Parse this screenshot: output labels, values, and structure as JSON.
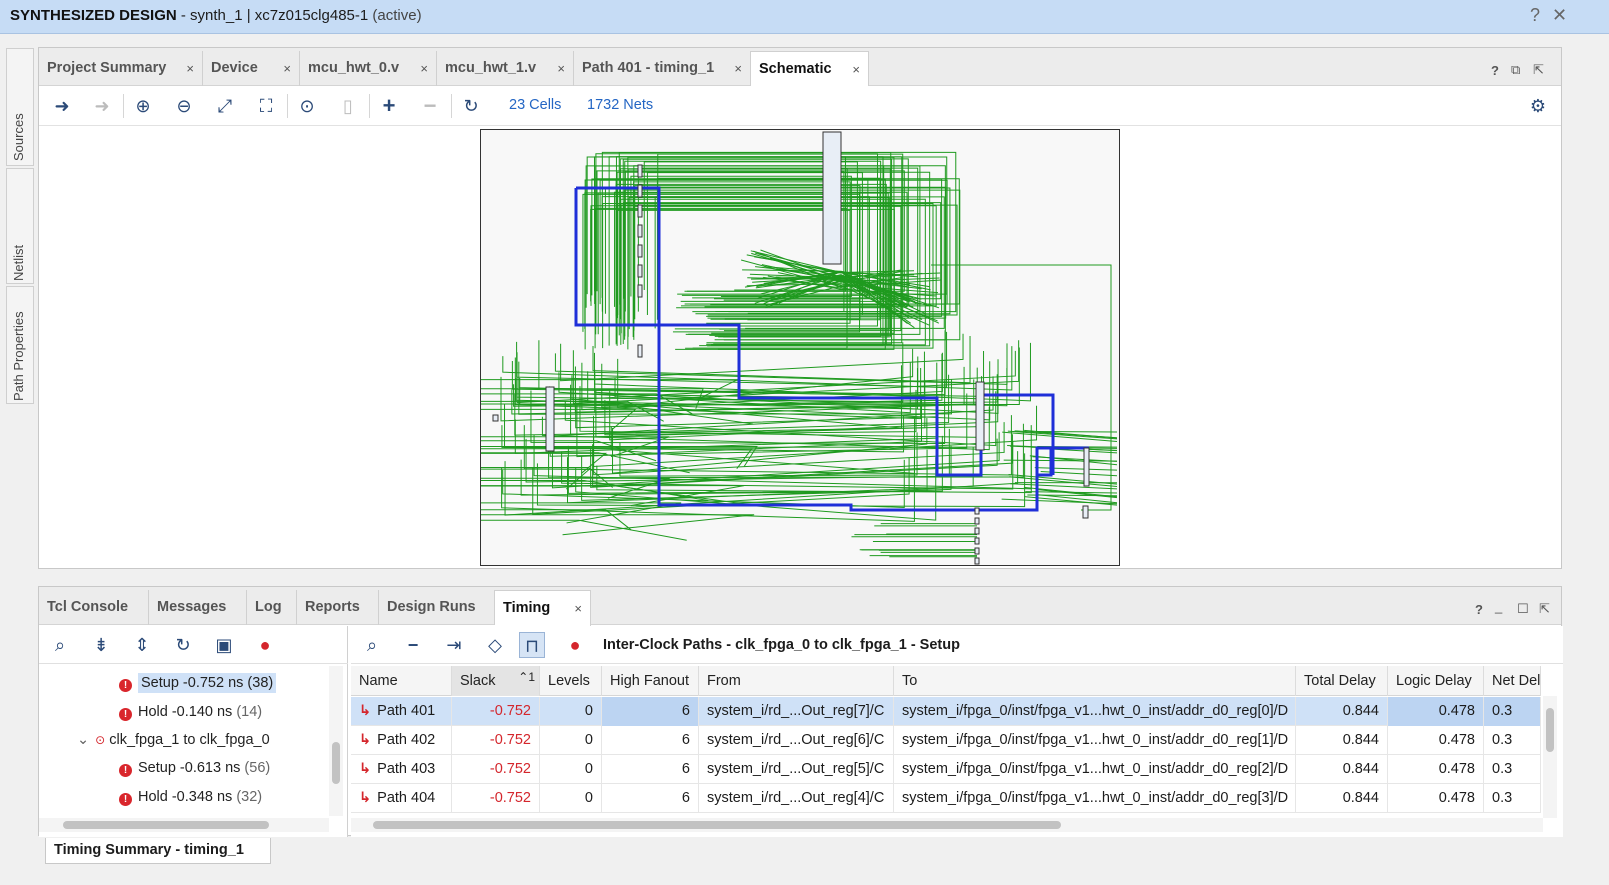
{
  "titlebar": {
    "design": "SYNTHESIZED DESIGN",
    "rest": " - synth_1 | xc7z015clg485-1",
    "status": "(active)",
    "help": "?",
    "close": "✕"
  },
  "side_tabs": [
    "Sources",
    "Netlist",
    "Path Properties"
  ],
  "top_tabs": [
    {
      "label": "Project Summary"
    },
    {
      "label": "Device"
    },
    {
      "label": "mcu_hwt_0.v"
    },
    {
      "label": "mcu_hwt_1.v"
    },
    {
      "label": "Path 401 - timing_1"
    },
    {
      "label": "Schematic"
    }
  ],
  "tab_close": "×",
  "schematic_toolbar": {
    "cells": "23 Cells",
    "nets": "1732 Nets"
  },
  "bottom_tabs": [
    {
      "label": "Tcl Console"
    },
    {
      "label": "Messages"
    },
    {
      "label": "Log"
    },
    {
      "label": "Reports"
    },
    {
      "label": "Design Runs"
    },
    {
      "label": "Timing"
    }
  ],
  "tree": {
    "rows": [
      {
        "label": "Setup -0.752 ns",
        "count": "(38)"
      },
      {
        "label": "Hold -0.140 ns",
        "count": "(14)"
      },
      {
        "label": "clk_fpga_1 to clk_fpga_0"
      },
      {
        "label": "Setup -0.613 ns",
        "count": "(56)"
      },
      {
        "label": "Hold -0.348 ns",
        "count": "(32)"
      }
    ]
  },
  "timing_table": {
    "title": "Inter-Clock Paths - clk_fpga_0 to clk_fpga_1 - Setup",
    "sort_indicator": "1",
    "columns": [
      "Name",
      "Slack",
      "Levels",
      "High Fanout",
      "From",
      "To",
      "Total Delay",
      "Logic Delay",
      "Net Del"
    ],
    "rows": [
      {
        "name": "Path 401",
        "slack": "-0.752",
        "levels": "0",
        "fanout": "6",
        "from": "system_i/rd_...Out_reg[7]/C",
        "to": "system_i/fpga_0/inst/fpga_v1...hwt_0_inst/addr_d0_reg[0]/D",
        "total": "0.844",
        "logic": "0.478",
        "net": "0.3"
      },
      {
        "name": "Path 402",
        "slack": "-0.752",
        "levels": "0",
        "fanout": "6",
        "from": "system_i/rd_...Out_reg[6]/C",
        "to": "system_i/fpga_0/inst/fpga_v1...hwt_0_inst/addr_d0_reg[1]/D",
        "total": "0.844",
        "logic": "0.478",
        "net": "0.3"
      },
      {
        "name": "Path 403",
        "slack": "-0.752",
        "levels": "0",
        "fanout": "6",
        "from": "system_i/rd_...Out_reg[5]/C",
        "to": "system_i/fpga_0/inst/fpga_v1...hwt_0_inst/addr_d0_reg[2]/D",
        "total": "0.844",
        "logic": "0.478",
        "net": "0.3"
      },
      {
        "name": "Path 404",
        "slack": "-0.752",
        "levels": "0",
        "fanout": "6",
        "from": "system_i/rd_...Out_reg[4]/C",
        "to": "system_i/fpga_0/inst/fpga_v1...hwt_0_inst/addr_d0_reg[3]/D",
        "total": "0.844",
        "logic": "0.478",
        "net": "0.3"
      }
    ]
  },
  "bottom_tab": "Timing Summary - timing_1",
  "colors": {
    "accent": "#2466c4",
    "error": "#d4262c",
    "net_green": "#1f9a1f",
    "net_blue": "#1f2fd8"
  }
}
